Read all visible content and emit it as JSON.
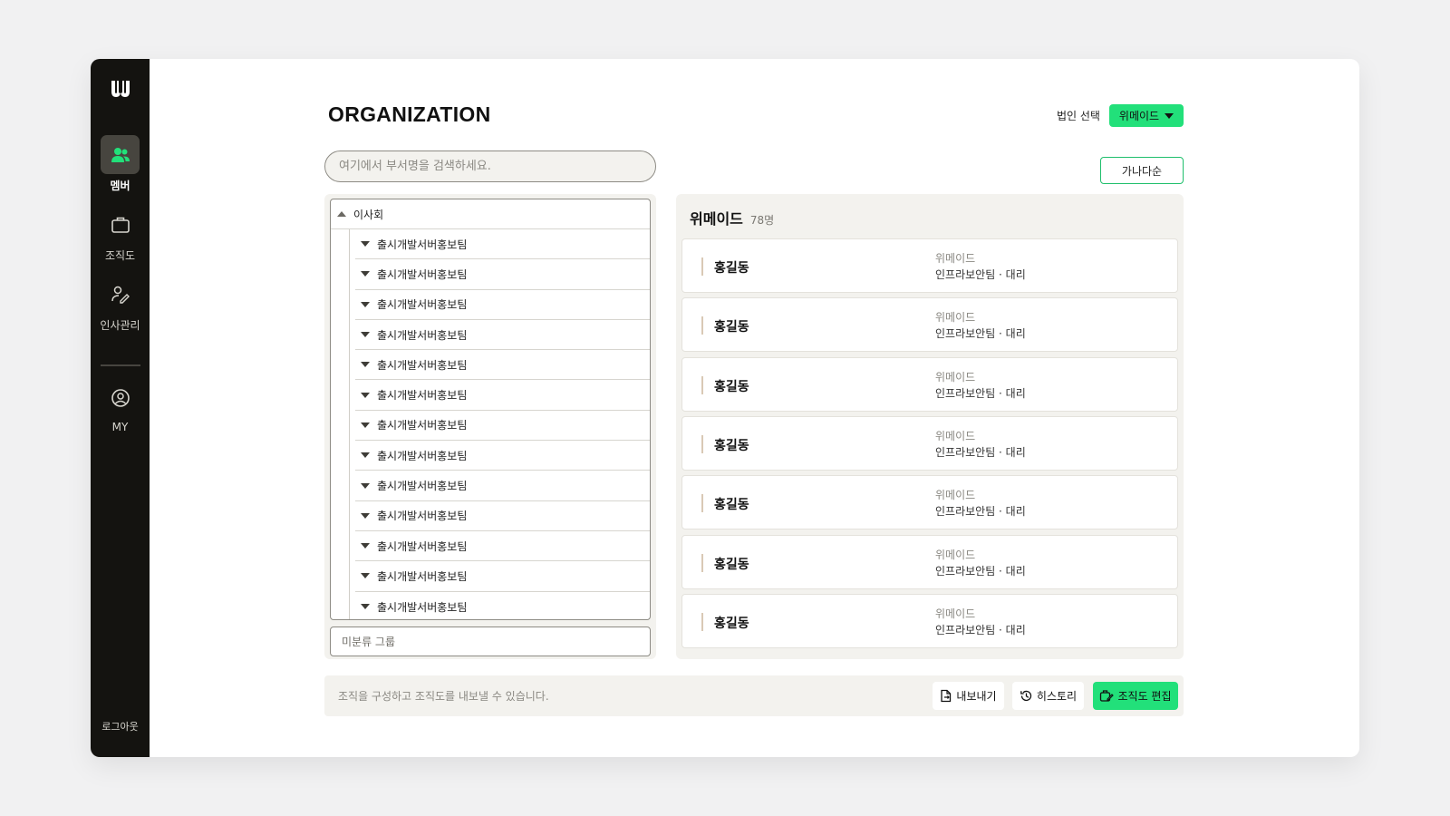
{
  "sidebar": {
    "logo": "W",
    "items": [
      {
        "label": "멤버",
        "icon": "people-icon",
        "active": true
      },
      {
        "label": "조직도",
        "icon": "briefcase-icon",
        "active": false
      },
      {
        "label": "인사관리",
        "icon": "user-edit-icon",
        "active": false
      },
      {
        "label": "MY",
        "icon": "user-circle-icon",
        "active": false
      }
    ],
    "logout_label": "로그아웃"
  },
  "header": {
    "title": "ORGANIZATION",
    "corp_label": "법인 선택",
    "corp_selected": "위메이드"
  },
  "search": {
    "placeholder": "여기에서 부서명을 검색하세요."
  },
  "sort_label": "가나다순",
  "tree": {
    "root_label": "이사회",
    "children": [
      "출시개발서버홍보팀",
      "출시개발서버홍보팀",
      "출시개발서버홍보팀",
      "출시개발서버홍보팀",
      "출시개발서버홍보팀",
      "출시개발서버홍보팀",
      "출시개발서버홍보팀",
      "출시개발서버홍보팀",
      "출시개발서버홍보팀",
      "출시개발서버홍보팀",
      "출시개발서버홍보팀",
      "출시개발서버홍보팀",
      "출시개발서버홍보팀"
    ],
    "ungrouped_label": "미분류 그룹"
  },
  "members": {
    "company": "위메이드",
    "count": "78명",
    "list": [
      {
        "name": "홍길동",
        "company": "위메이드",
        "dept": "인프라보안팀 · 대리"
      },
      {
        "name": "홍길동",
        "company": "위메이드",
        "dept": "인프라보안팀 · 대리"
      },
      {
        "name": "홍길동",
        "company": "위메이드",
        "dept": "인프라보안팀 · 대리"
      },
      {
        "name": "홍길동",
        "company": "위메이드",
        "dept": "인프라보안팀 · 대리"
      },
      {
        "name": "홍길동",
        "company": "위메이드",
        "dept": "인프라보안팀 · 대리"
      },
      {
        "name": "홍길동",
        "company": "위메이드",
        "dept": "인프라보안팀 · 대리"
      },
      {
        "name": "홍길동",
        "company": "위메이드",
        "dept": "인프라보안팀 · 대리"
      }
    ]
  },
  "footer": {
    "hint": "조직을 구성하고 조직도를 내보낼 수 있습니다.",
    "export_label": "내보내기",
    "history_label": "히스토리",
    "edit_label": "조직도 편집"
  },
  "colors": {
    "accent": "#22e07a",
    "sidebar_bg": "#141310",
    "panel_bg": "#f3f2ee"
  }
}
